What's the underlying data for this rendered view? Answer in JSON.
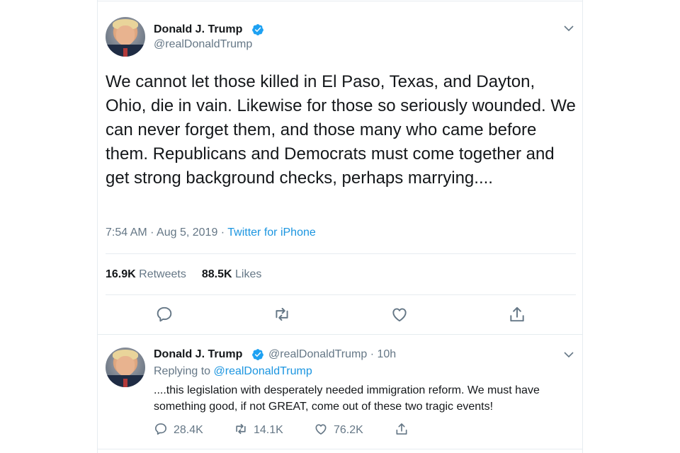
{
  "colors": {
    "accent": "#1b95e0",
    "muted": "#657786",
    "text": "#14171a",
    "border": "#e6ecf0"
  },
  "main_tweet": {
    "author_name": "Donald J. Trump",
    "handle": "@realDonaldTrump",
    "text": "We cannot let those killed in El Paso, Texas, and Dayton, Ohio, die in vain. Likewise for those so seriously wounded. We can never forget them, and those many who came before them. Republicans and Democrats must come together and get strong background checks, perhaps marrying....",
    "time_date": "7:54 AM · Aug 5, 2019 · ",
    "source": "Twitter for iPhone",
    "retweets_count": "16.9K",
    "retweets_label": "Retweets",
    "likes_count": "88.5K",
    "likes_label": "Likes",
    "actions": [
      "reply-icon",
      "retweet-icon",
      "like-icon",
      "share-icon"
    ]
  },
  "reply_tweet": {
    "author_name": "Donald J. Trump",
    "handle_time": "@realDonaldTrump · 10h",
    "replying_prefix": "Replying to ",
    "replying_to": "@realDonaldTrump",
    "text": "....this legislation with desperately needed immigration reform. We must have something good, if not GREAT, come out of these two tragic events!",
    "reply_count": "28.4K",
    "retweet_count": "14.1K",
    "like_count": "76.2K"
  }
}
